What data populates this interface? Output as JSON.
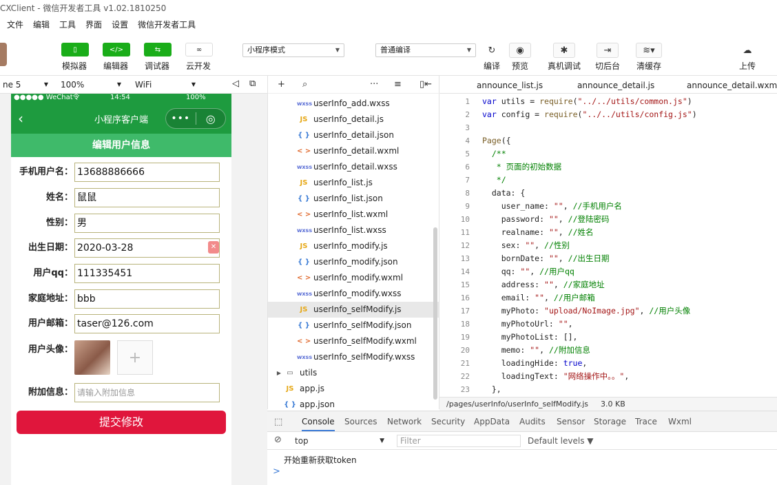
{
  "window": {
    "title": "CXClient - 微信开发者工具 v1.02.1810250"
  },
  "menu": [
    "文件",
    "编辑",
    "工具",
    "界面",
    "设置",
    "微信开发者工具"
  ],
  "toolbar": {
    "simulator": "模拟器",
    "editor": "编辑器",
    "debugger": "调试器",
    "cloud": "云开发",
    "mode": "小程序模式",
    "compile": "普通编译",
    "compile_btn": "编译",
    "preview": "预览",
    "realdebug": "真机调试",
    "backend": "切后台",
    "clearcache": "清缓存",
    "upload": "上传"
  },
  "sim_bar": {
    "device": "ne 5",
    "zoom": "100%",
    "network": "WiFi"
  },
  "phone": {
    "status_left": "●●●●● WeChat令",
    "status_time": "14:54",
    "status_right": "100%",
    "nav_title": "小程序客户端",
    "page_title": "编辑用户信息",
    "fields": [
      {
        "label": "手机用户名：",
        "value": "13688886666"
      },
      {
        "label": "姓名：",
        "value": "鼠鼠"
      },
      {
        "label": "性别：",
        "value": "男"
      },
      {
        "label": "出生日期：",
        "value": "2020-03-28"
      },
      {
        "label": "用户qq：",
        "value": "111335451"
      },
      {
        "label": "家庭地址：",
        "value": "bbb"
      },
      {
        "label": "用户邮箱：",
        "value": "taser@126.com"
      }
    ],
    "photo_label": "用户头像：",
    "memo_label": "附加信息：",
    "memo_placeholder": "请输入附加信息",
    "submit": "提交修改"
  },
  "filetree": {
    "files": [
      {
        "type": "wxss",
        "icon": "wxss",
        "name": "userInfo_add.wxss"
      },
      {
        "type": "js",
        "icon": "JS",
        "name": "userInfo_detail.js"
      },
      {
        "type": "json",
        "icon": "{ }",
        "name": "userInfo_detail.json"
      },
      {
        "type": "wxml",
        "icon": "< >",
        "name": "userInfo_detail.wxml"
      },
      {
        "type": "wxss",
        "icon": "wxss",
        "name": "userInfo_detail.wxss"
      },
      {
        "type": "js",
        "icon": "JS",
        "name": "userInfo_list.js"
      },
      {
        "type": "json",
        "icon": "{ }",
        "name": "userInfo_list.json"
      },
      {
        "type": "wxml",
        "icon": "< >",
        "name": "userInfo_list.wxml"
      },
      {
        "type": "wxss",
        "icon": "wxss",
        "name": "userInfo_list.wxss"
      },
      {
        "type": "js",
        "icon": "JS",
        "name": "userInfo_modify.js"
      },
      {
        "type": "json",
        "icon": "{ }",
        "name": "userInfo_modify.json"
      },
      {
        "type": "wxml",
        "icon": "< >",
        "name": "userInfo_modify.wxml"
      },
      {
        "type": "wxss",
        "icon": "wxss",
        "name": "userInfo_modify.wxss"
      },
      {
        "type": "js",
        "icon": "JS",
        "name": "userInfo_selfModify.js",
        "selected": true
      },
      {
        "type": "json",
        "icon": "{ }",
        "name": "userInfo_selfModify.json"
      },
      {
        "type": "wxml",
        "icon": "< >",
        "name": "userInfo_selfModify.wxml"
      },
      {
        "type": "wxss",
        "icon": "wxss",
        "name": "userInfo_selfModify.wxss"
      }
    ],
    "folder": "utils",
    "root_files": [
      {
        "type": "js",
        "icon": "JS",
        "name": "app.js"
      },
      {
        "type": "json",
        "icon": "{ }",
        "name": "app.json"
      }
    ]
  },
  "editor": {
    "tabs": [
      "announce_list.js",
      "announce_detail.js",
      "announce_detail.wxml"
    ],
    "lines": [
      {
        "n": "1",
        "html": "<span class=\"kw\">var</span> utils = <span class=\"fn\">require</span>(<span class=\"str\">\"../../utils/common.js\"</span>)"
      },
      {
        "n": "2",
        "html": "<span class=\"kw\">var</span> config = <span class=\"fn\">require</span>(<span class=\"str\">\"../../utils/config.js\"</span>)"
      },
      {
        "n": "3",
        "html": ""
      },
      {
        "n": "4",
        "html": "<span class=\"fn\">Page</span>({"
      },
      {
        "n": "5",
        "html": "  <span class=\"cm\">/**</span>"
      },
      {
        "n": "6",
        "html": "  <span class=\"cm\"> * 页面的初始数据</span>"
      },
      {
        "n": "7",
        "html": "  <span class=\"cm\"> */</span>"
      },
      {
        "n": "8",
        "html": "  data: {"
      },
      {
        "n": "9",
        "html": "    user_name: <span class=\"str\">\"\"</span>, <span class=\"cm\">//手机用户名</span>"
      },
      {
        "n": "10",
        "html": "    password: <span class=\"str\">\"\"</span>, <span class=\"cm\">//登陆密码</span>"
      },
      {
        "n": "11",
        "html": "    realname: <span class=\"str\">\"\"</span>, <span class=\"cm\">//姓名</span>"
      },
      {
        "n": "12",
        "html": "    sex: <span class=\"str\">\"\"</span>, <span class=\"cm\">//性别</span>"
      },
      {
        "n": "13",
        "html": "    bornDate: <span class=\"str\">\"\"</span>, <span class=\"cm\">//出生日期</span>"
      },
      {
        "n": "14",
        "html": "    qq: <span class=\"str\">\"\"</span>, <span class=\"cm\">//用户qq</span>"
      },
      {
        "n": "15",
        "html": "    address: <span class=\"str\">\"\"</span>, <span class=\"cm\">//家庭地址</span>"
      },
      {
        "n": "16",
        "html": "    email: <span class=\"str\">\"\"</span>, <span class=\"cm\">//用户邮箱</span>"
      },
      {
        "n": "17",
        "html": "    myPhoto: <span class=\"str\">\"upload/NoImage.jpg\"</span>, <span class=\"cm\">//用户头像</span>"
      },
      {
        "n": "18",
        "html": "    myPhotoUrl: <span class=\"str\">\"\"</span>,"
      },
      {
        "n": "19",
        "html": "    myPhotoList: [],"
      },
      {
        "n": "20",
        "html": "    memo: <span class=\"str\">\"\"</span>, <span class=\"cm\">//附加信息</span>"
      },
      {
        "n": "21",
        "html": "    loadingHide: <span class=\"kw\">true</span>,"
      },
      {
        "n": "22",
        "html": "    loadingText: <span class=\"str\">\"网络操作中。。\"</span>,"
      },
      {
        "n": "23",
        "html": "  },"
      }
    ],
    "status_path": "/pages/userInfo/userInfo_selfModify.js",
    "status_size": "3.0 KB"
  },
  "devtools": {
    "tabs": [
      "Console",
      "Sources",
      "Network",
      "Security",
      "AppData",
      "Audits",
      "Sensor",
      "Storage",
      "Trace",
      "Wxml"
    ],
    "context": "top",
    "filter_placeholder": "Filter",
    "levels": "Default levels ▼",
    "message": "开始重新获取token",
    "prompt": ">"
  },
  "colors": {
    "wechat_green": "#1e9b3f",
    "header_green": "#3fba6a",
    "submit_red": "#e0163c",
    "tool_green": "#1aad19"
  }
}
